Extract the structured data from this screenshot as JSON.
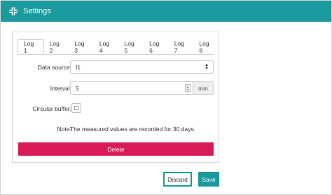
{
  "window": {
    "title": "Settings",
    "icon": "collapse-arrows-icon",
    "header_color": "#1a9a9c"
  },
  "tabs": [
    {
      "label": "Log 1",
      "active": true
    },
    {
      "label": "Log 2",
      "active": false
    },
    {
      "label": "Log 3",
      "active": false
    },
    {
      "label": "Log 4",
      "active": false
    },
    {
      "label": "Log 5",
      "active": false
    },
    {
      "label": "Log 6",
      "active": false
    },
    {
      "label": "Log 7",
      "active": false
    },
    {
      "label": "Log 8",
      "active": false
    }
  ],
  "form": {
    "data_source": {
      "label": "Data source:",
      "value": "I1"
    },
    "interval": {
      "label": "Interval:",
      "value": "5",
      "unit": "min"
    },
    "circular_buffer": {
      "label": "Circular buffer:",
      "checked": false
    },
    "note": {
      "label": "Note:",
      "text": "The measured values are recorded for 30 days."
    }
  },
  "buttons": {
    "delete": "Delete",
    "discard": "Discard",
    "save": "Save"
  },
  "colors": {
    "accent": "#1a9a9c",
    "danger": "#d81b56"
  }
}
